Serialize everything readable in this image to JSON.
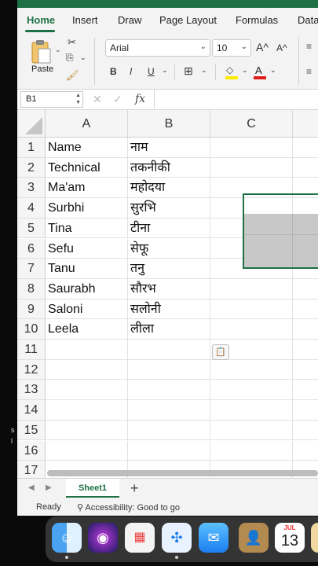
{
  "ribbon": {
    "tabs": [
      "Home",
      "Insert",
      "Draw",
      "Page Layout",
      "Formulas",
      "Data"
    ],
    "active_tab": "Home",
    "paste_label": "Paste",
    "font_name": "Arial",
    "font_size": "10",
    "bold": "B",
    "italic": "I",
    "underline": "U",
    "grow_font": "A^",
    "shrink_font": "A^",
    "font_color_glyph": "A"
  },
  "formula_bar": {
    "name_box": "B1",
    "fx": "fx",
    "cancel": "✕",
    "enter": "✓",
    "content": ""
  },
  "grid": {
    "columns": [
      "A",
      "B",
      "C"
    ],
    "rows": [
      {
        "num": "1",
        "a": "Name",
        "b": "नाम"
      },
      {
        "num": "2",
        "a": "Technical",
        "b": "तकनीकी"
      },
      {
        "num": "3",
        "a": "Ma'am",
        "b": "महोदया"
      },
      {
        "num": "4",
        "a": "Surbhi",
        "b": "सुरभि"
      },
      {
        "num": "5",
        "a": "Tina",
        "b": "टीना"
      },
      {
        "num": "6",
        "a": "Sefu",
        "b": "सेफू"
      },
      {
        "num": "7",
        "a": "Tanu",
        "b": "तनु"
      },
      {
        "num": "8",
        "a": "Saurabh",
        "b": "सौरभ"
      },
      {
        "num": "9",
        "a": "Saloni",
        "b": "सलोनी"
      },
      {
        "num": "10",
        "a": "Leela",
        "b": "लीला"
      },
      {
        "num": "11",
        "a": "",
        "b": ""
      },
      {
        "num": "12",
        "a": "",
        "b": ""
      },
      {
        "num": "13",
        "a": "",
        "b": ""
      },
      {
        "num": "14",
        "a": "",
        "b": ""
      },
      {
        "num": "15",
        "a": "",
        "b": ""
      },
      {
        "num": "16",
        "a": "",
        "b": ""
      },
      {
        "num": "17",
        "a": "",
        "b": ""
      }
    ]
  },
  "sheets": {
    "tabs": [
      "Sheet1"
    ],
    "add": "+"
  },
  "status": {
    "ready": "Ready",
    "accessibility": "Accessibility: Good to go"
  },
  "dock": {
    "calendar_month": "JUL",
    "calendar_day": "13"
  },
  "colors": {
    "accent": "#1e7145"
  }
}
